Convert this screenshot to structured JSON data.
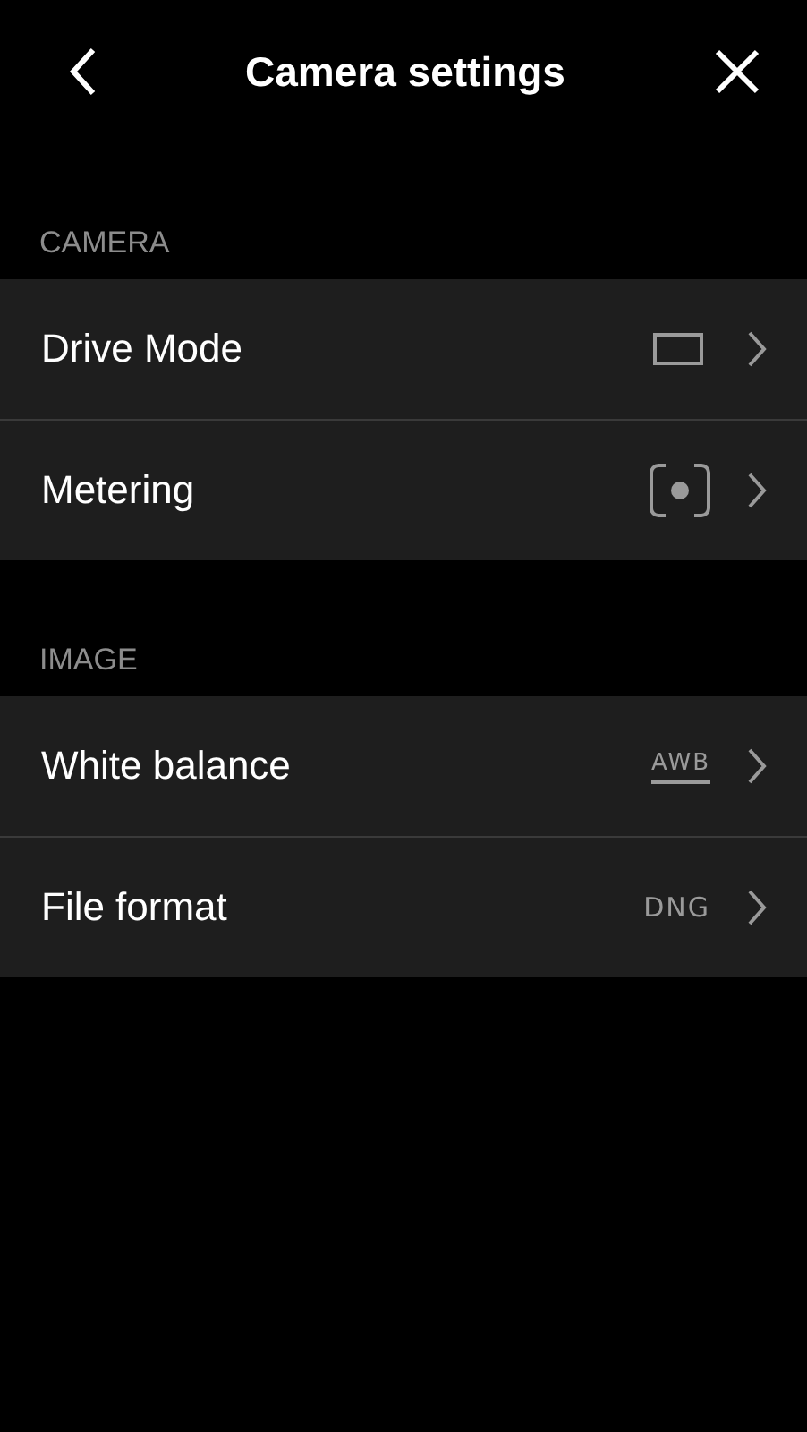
{
  "header": {
    "title": "Camera settings"
  },
  "sections": [
    {
      "label": "CAMERA",
      "rows": [
        {
          "label": "Drive Mode",
          "kind": "frame"
        },
        {
          "label": "Metering",
          "kind": "spot"
        }
      ]
    },
    {
      "label": "IMAGE",
      "rows": [
        {
          "label": "White balance",
          "kind": "underlined",
          "value": "AWB"
        },
        {
          "label": "File format",
          "kind": "text",
          "value": "DNG"
        }
      ]
    }
  ]
}
